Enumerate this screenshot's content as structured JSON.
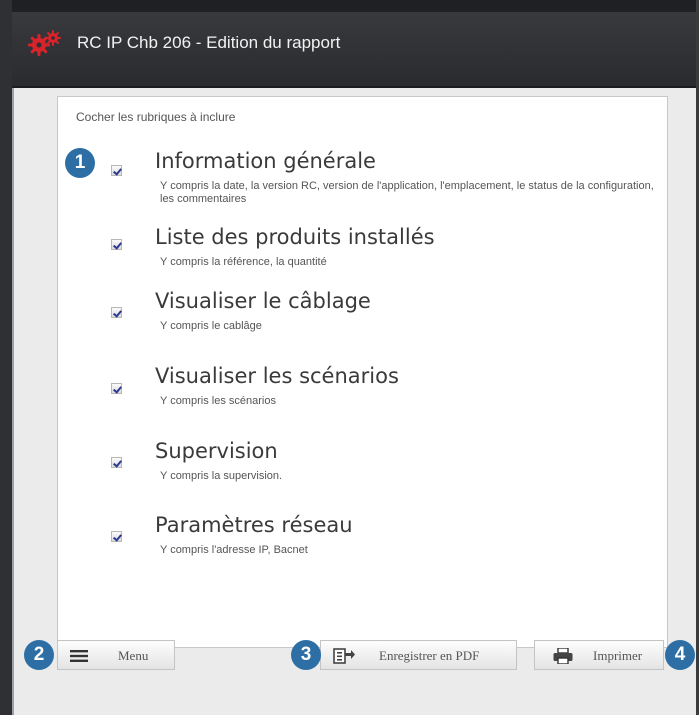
{
  "window": {
    "title": "RC IP Chb 206 - Edition du rapport",
    "icon": "gears-icon",
    "accent_color": "#d9232a"
  },
  "panel": {
    "instructions": "Cocher les rubriques à inclure",
    "options": [
      {
        "title": "Information générale",
        "description": "Y compris la date, la version RC, version de l'application, l'emplacement, le status de la configuration, les commentaires",
        "checked": true
      },
      {
        "title": "Liste des produits installés",
        "description": "Y compris la référence, la quantité",
        "checked": true
      },
      {
        "title": "Visualiser le câblage",
        "description": "Y compris le cablâge",
        "checked": true
      },
      {
        "title": "Visualiser les scénarios",
        "description": "Y compris les scénarios",
        "checked": true
      },
      {
        "title": "Supervision",
        "description": "Y compris la supervision.",
        "checked": true
      },
      {
        "title": "Paramètres réseau",
        "description": "Y compris l'adresse IP, Bacnet",
        "checked": true
      }
    ]
  },
  "footer": {
    "menu_label": "Menu",
    "menu_icon": "hamburger-icon",
    "pdf_label": "Enregistrer en PDF",
    "pdf_icon": "export-pdf-icon",
    "print_label": "Imprimer",
    "print_icon": "printer-icon"
  },
  "callouts": [
    "1",
    "2",
    "3",
    "4"
  ],
  "colors": {
    "titlebar": "#2e2f33",
    "callout": "#2d6fa5",
    "checkmark": "#2b3a8f"
  }
}
